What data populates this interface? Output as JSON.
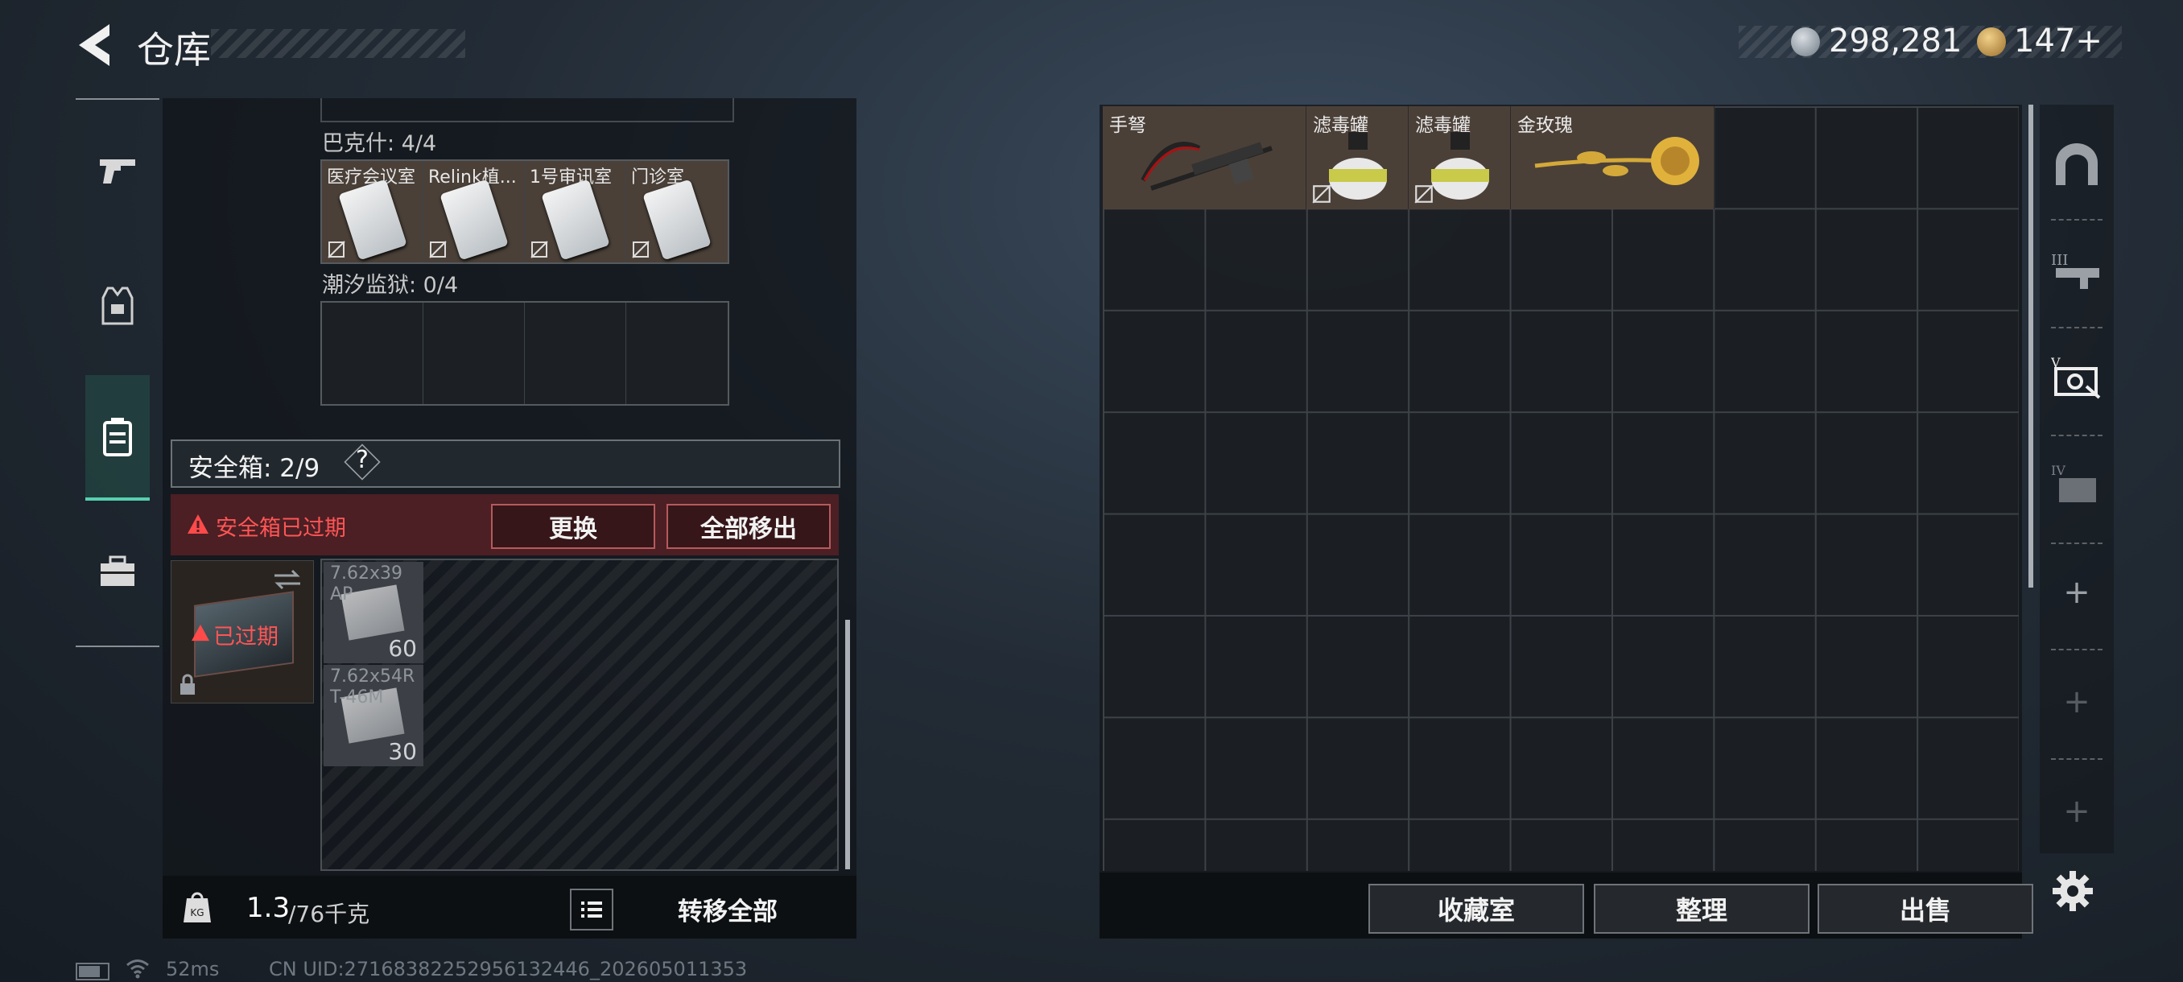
{
  "header": {
    "title": "仓库",
    "back_icon": "back-arrow-icon"
  },
  "currency": {
    "silver_value": "298,281",
    "gold_value": "147+",
    "silver_icon": "silver-coin-icon",
    "gold_icon": "gold-coin-icon"
  },
  "left_nav": [
    {
      "name": "weapon-tab",
      "icon": "pistol-icon"
    },
    {
      "name": "armor-tab",
      "icon": "vest-icon"
    },
    {
      "name": "safebox-tab",
      "icon": "case-icon",
      "active": true
    },
    {
      "name": "toolbox-tab",
      "icon": "toolbox-icon"
    }
  ],
  "keys": {
    "group1_label": "巴克什: 4/4",
    "group1_items": [
      "医疗会议室",
      "Relink植...",
      "1号审讯室",
      "门诊室"
    ],
    "group2_label": "潮汐监狱: 0/4"
  },
  "safebox": {
    "label": "安全箱: 2/9",
    "help": "?",
    "expired_notice": "安全箱已过期",
    "replace_button": "更换",
    "move_all_out_button": "全部移出",
    "expired_badge": "已过期"
  },
  "ammo": [
    {
      "name": "7.62x39",
      "sub": "AP",
      "count": "60"
    },
    {
      "name": "7.62x54R",
      "sub": "T-46M",
      "count": "30"
    }
  ],
  "weight": {
    "current": "1.3",
    "max": "/76千克",
    "icon": "weight-icon"
  },
  "footer_left": {
    "list_icon": "list-icon",
    "transfer_all": "转移全部"
  },
  "storage_items": [
    {
      "name": "手弩",
      "icon": "crossbow-icon"
    },
    {
      "name": "滤毒罐",
      "icon": "filter-canister-icon"
    },
    {
      "name": "滤毒罐",
      "icon": "filter-canister-icon"
    },
    {
      "name": "金玫瑰",
      "icon": "golden-rose-icon"
    }
  ],
  "footer_right": {
    "collection_room": "收藏室",
    "sort": "整理",
    "sell": "出售"
  },
  "right_nav": {
    "add_labels": [
      "+",
      "+",
      "+"
    ],
    "settings_icon": "gear-icon"
  },
  "status_bar": {
    "ping": "52ms",
    "uid": "CN UID:27168382252956132446_202605011353"
  }
}
